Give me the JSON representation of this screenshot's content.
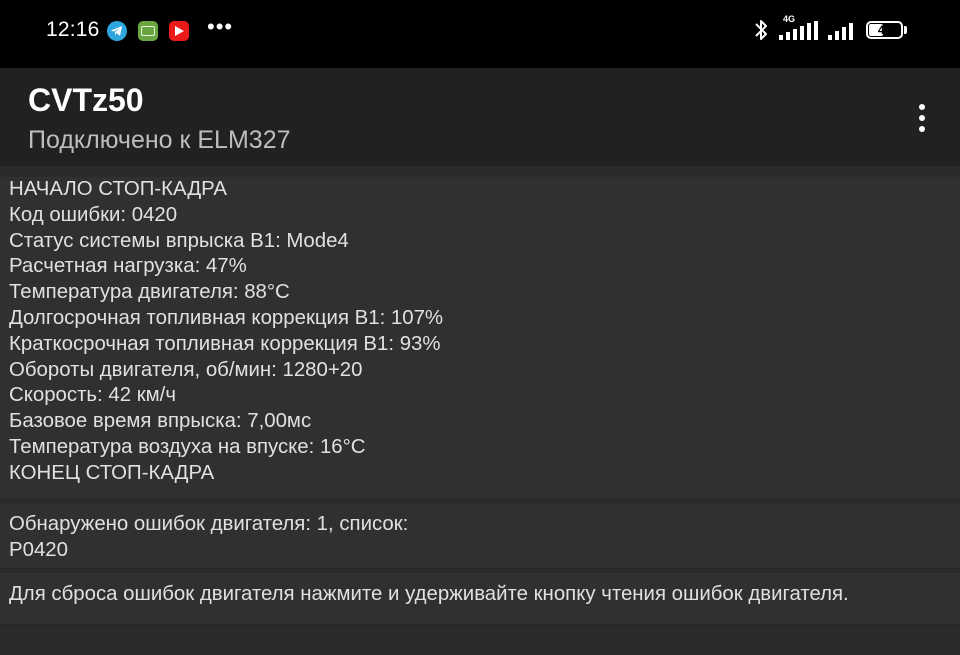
{
  "status_bar": {
    "time": "12:16",
    "more_indicator": "•••",
    "network_type": "4G",
    "battery_level": 46,
    "battery_label": "46",
    "notification_icons": [
      "telegram-icon",
      "gallery-icon",
      "youtube-icon"
    ],
    "system_icons": [
      "bluetooth-icon",
      "signal-icon",
      "signal-icon",
      "battery-icon"
    ]
  },
  "app_bar": {
    "title": "CVTz50",
    "subtitle": "Подключено к ELM327",
    "menu_icon": "overflow-menu-icon"
  },
  "freeze_frame": {
    "lines": [
      "НАЧАЛО СТОП-КАДРА",
      "Код ошибки: 0420",
      "Статус системы впрыска B1: Mode4",
      "Расчетная нагрузка: 47%",
      "Температура двигателя: 88°C",
      "Долгосрочная топливная коррекция B1: 107%",
      "Краткосрочная топливная коррекция B1: 93%",
      "Обороты двигателя, об/мин: 1280+20",
      "Скорость: 42 км/ч",
      "Базовое время впрыска: 7,00мс",
      "Температура воздуха на впуске: 16°C",
      "КОНЕЦ СТОП-КАДРА"
    ]
  },
  "errors": {
    "lines": [
      "Обнаружено ошибок двигателя: 1, список:",
      "P0420"
    ]
  },
  "hint": {
    "text": "Для сброса ошибок двигателя нажмите и удерживайте кнопку чтения ошибок двигателя."
  },
  "colors": {
    "status_bar_bg": "#000000",
    "app_bar_bg": "#212121",
    "content_bg": "#2b2b2b",
    "block_bg": "#303030",
    "text": "#e0e0e0",
    "subtitle": "#bdbdbd"
  }
}
